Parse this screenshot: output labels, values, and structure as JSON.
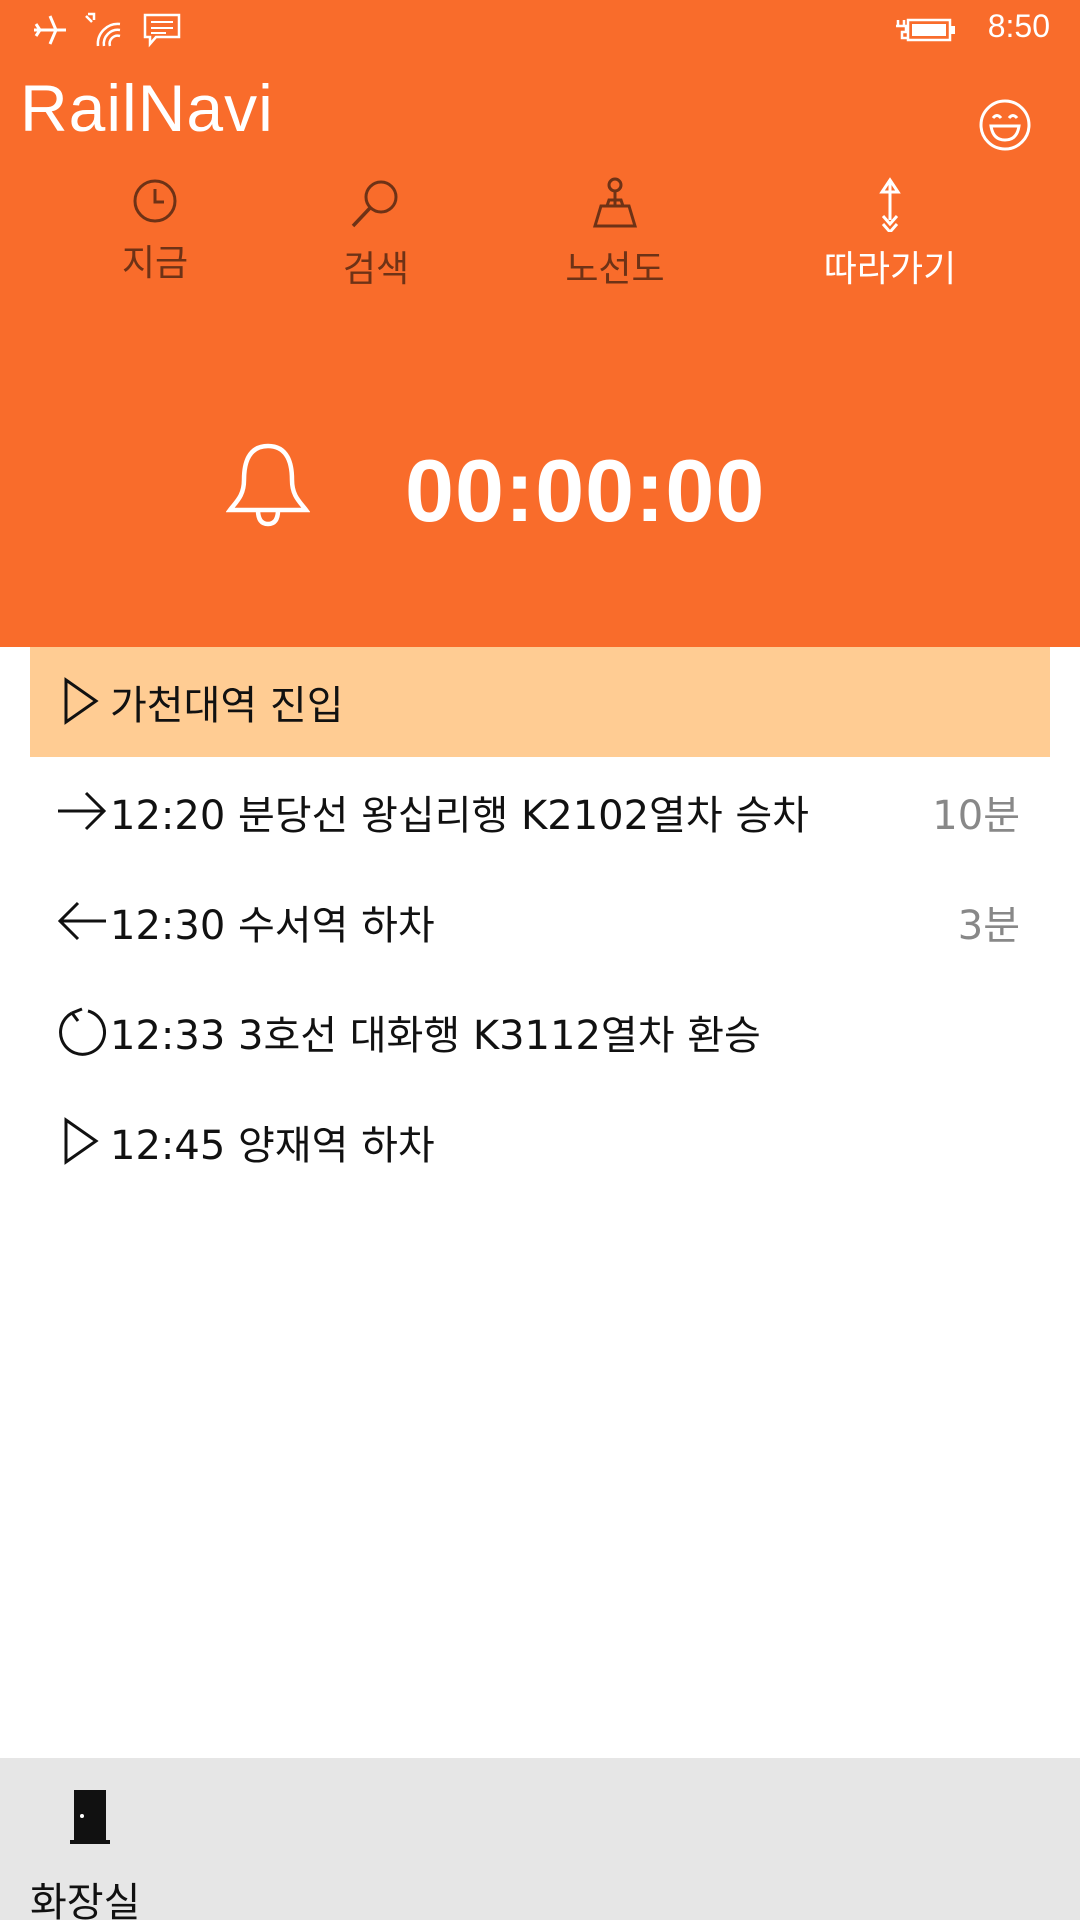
{
  "status_bar": {
    "time": "8:50",
    "icons": [
      "airplane-icon",
      "wifi-icon",
      "message-icon",
      "battery-charging-icon"
    ]
  },
  "app": {
    "title": "RailNavi",
    "action_icon": "smiley-icon"
  },
  "nav": {
    "tabs": [
      {
        "label": "지금",
        "icon": "clock-icon"
      },
      {
        "label": "검색",
        "icon": "search-icon"
      },
      {
        "label": "노선도",
        "icon": "map-pin-icon"
      },
      {
        "label": "따라가기",
        "icon": "follow-arrow-icon"
      }
    ]
  },
  "timer": {
    "icon": "bell-icon",
    "value": "00:00:00"
  },
  "route": {
    "items": [
      {
        "icon": "play-triangle-icon",
        "text": "가천대역 진입",
        "duration": ""
      },
      {
        "icon": "arrow-right-icon",
        "text": "12:20 분당선 왕십리행 K2102열차 승차",
        "duration": "10분"
      },
      {
        "icon": "arrow-left-icon",
        "text": "12:30 수서역 하차",
        "duration": "3분"
      },
      {
        "icon": "refresh-icon",
        "text": "12:33 3호선 대화행 K3112열차 환승",
        "duration": ""
      },
      {
        "icon": "play-triangle-icon",
        "text": "12:45 양재역 하차",
        "duration": ""
      }
    ]
  },
  "bottom_bar": {
    "button_label": "화장실",
    "button_icon": "door-icon"
  },
  "colors": {
    "accent": "#f96c2b",
    "highlight": "#ffcc93",
    "bottom_bar": "#e6e6e6"
  }
}
